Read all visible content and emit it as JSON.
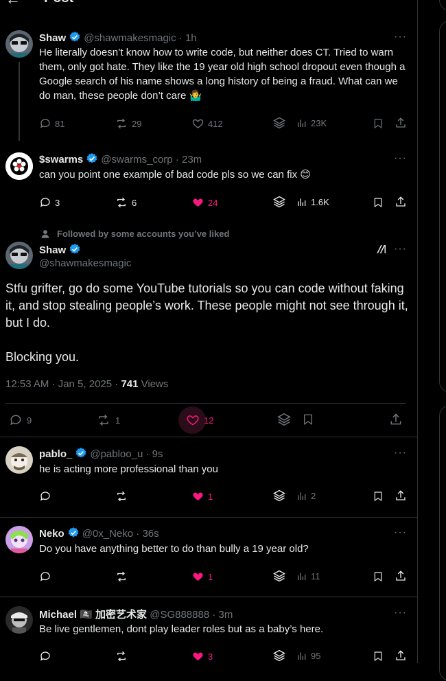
{
  "header": {
    "title": "Post"
  },
  "replies_above": [
    {
      "name": "Shaw",
      "handle": "@shawmakesmagic",
      "time": "· 1h",
      "text": "He literally doesn’t know how to write code, but neither does CT. Tried to warn them, only got hate. They like the 19 year old high school dropout even though a Google search of his name shows a long history of being a fraud. What can we do man, these people don’t care 🤷‍♂️",
      "replies": "81",
      "reposts": "29",
      "likes": "412",
      "views": "23K"
    },
    {
      "name": "$swarms",
      "handle": "@swarms_corp",
      "time": "· 23m",
      "text": "can you point one example of bad code pls so we can fix 😊",
      "replies": "3",
      "reposts": "6",
      "likes": "24",
      "views": "1.6K"
    }
  ],
  "main_post": {
    "followed_note": "Followed by some accounts you’ve liked",
    "name": "Shaw",
    "handle": "@shawmakesmagic",
    "body1": "Stfu grifter, go do some YouTube tutorials so you can code without faking it, and stop stealing people’s work. These people might not see through it, but I do.",
    "body2": "Blocking you.",
    "timestamp": "12:53 AM · Jan 5, 2025 · ",
    "views_count": "741",
    "views_label": " Views",
    "replies": "9",
    "reposts": "1",
    "likes": "12"
  },
  "replies_below": [
    {
      "name": "pablo_",
      "handle": "@pabloo_u",
      "time": "· 9s",
      "text": "he is acting more professional than you",
      "likes": "1",
      "views": "2"
    },
    {
      "name": "Neko",
      "handle": "@0x_Neko",
      "time": "· 36s",
      "text": "Do you have anything better to do than bully a 19 year old?",
      "likes": "1",
      "views": "11"
    },
    {
      "name": "Michael 🏴‍☠️ 加密艺术家",
      "handle": "@SG888888",
      "time": "· 3m",
      "text": "Be live gentlemen, dont play leader roles but as a baby’s here.",
      "likes": "3",
      "views": "95"
    }
  ],
  "more_label": "···",
  "colors": {
    "like": "#f91880",
    "verified": "#1d9bf0",
    "muted": "#71767b",
    "border": "#2f3336"
  }
}
